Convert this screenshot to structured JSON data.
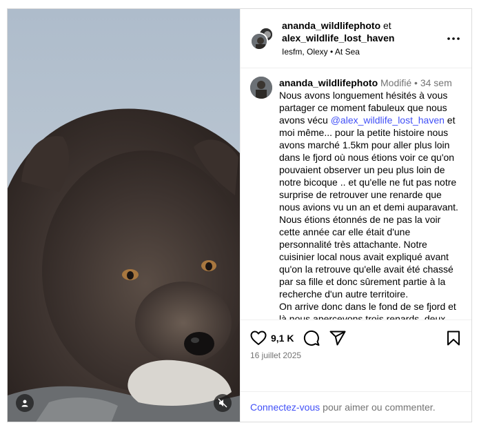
{
  "header": {
    "user1": "ananda_wildlifephoto",
    "conjunction": "et",
    "user2": "alex_wildlife_lost_haven",
    "audio": "Iesfm, Olexy",
    "separator": "•",
    "location": "At Sea"
  },
  "comment": {
    "username": "ananda_wildlifephoto",
    "edited": "Modifié",
    "dot": "•",
    "time": "34 sem",
    "caption_part1": "Nous avons longuement hésités à vous partager ce moment fabuleux que nous avons vécu ",
    "mention": "@alex_wildlife_lost_haven",
    "caption_part2": " et moi même... pour la petite histoire nous avons marché 1.5km pour aller plus loin dans le fjord où nous étions voir ce qu'on pouvaient observer un peu plus loin de notre bicoque .. et qu'elle ne fut pas notre surprise de retrouver une renarde que nous avions vu un an et demi auparavant.\nNous étions étonnés de ne pas la voir cette année car elle était d'une personnalité très attachante. Notre cuisinier local nous avait expliqué avant qu'on la retrouve qu'elle avait été chassé par sa fille et donc sûrement partie à la recherche d'un autre territoire.\nOn arrive donc dans le fond de se fjord et là nous apercevons trois renards, deux assez farouches et une/un qui reste à nous observer de loin. On se rapproche"
  },
  "actions": {
    "likes": "9,1 K",
    "date": "16 juillet 2025"
  },
  "login": {
    "link": "Connectez-vous",
    "text": "pour aimer ou commenter."
  },
  "icons": {
    "more": "more-horizontal-icon",
    "like": "heart-icon",
    "comment": "comment-icon",
    "share": "send-icon",
    "save": "bookmark-icon",
    "tag": "user-tag-icon",
    "mute": "audio-muted-icon"
  }
}
